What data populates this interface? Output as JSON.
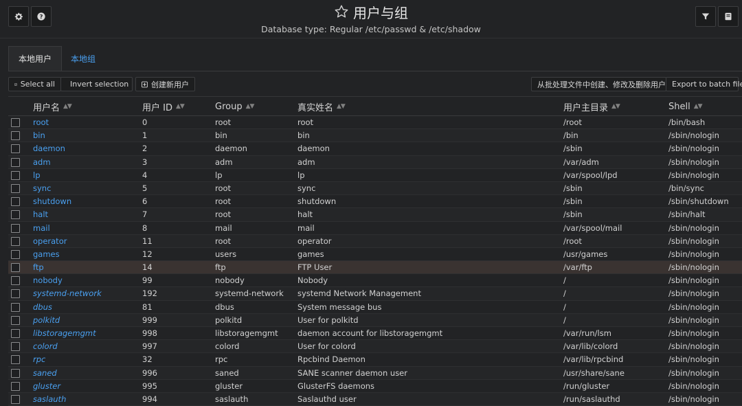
{
  "header": {
    "title": "用户与组",
    "subtitle": "Database type: Regular /etc/passwd & /etc/shadow"
  },
  "tabs": [
    {
      "label": "本地用户",
      "active": true
    },
    {
      "label": "本地组",
      "active": false
    }
  ],
  "toolbar": {
    "select_all": "Select all",
    "invert_selection": "Invert selection",
    "create_user": "创建新用户",
    "batch_file": "从批处理文件中创建、修改及删除用户",
    "export_batch": "Export to batch file"
  },
  "columns": {
    "username": "用户名",
    "uid": "用户 ID",
    "group": "Group",
    "real_name": "真实姓名",
    "home": "用户主目录",
    "shell": "Shell"
  },
  "users": [
    {
      "name": "root",
      "uid": "0",
      "group": "root",
      "real": "root",
      "home": "/root",
      "shell": "/bin/bash",
      "system": false
    },
    {
      "name": "bin",
      "uid": "1",
      "group": "bin",
      "real": "bin",
      "home": "/bin",
      "shell": "/sbin/nologin",
      "system": false
    },
    {
      "name": "daemon",
      "uid": "2",
      "group": "daemon",
      "real": "daemon",
      "home": "/sbin",
      "shell": "/sbin/nologin",
      "system": false
    },
    {
      "name": "adm",
      "uid": "3",
      "group": "adm",
      "real": "adm",
      "home": "/var/adm",
      "shell": "/sbin/nologin",
      "system": false
    },
    {
      "name": "lp",
      "uid": "4",
      "group": "lp",
      "real": "lp",
      "home": "/var/spool/lpd",
      "shell": "/sbin/nologin",
      "system": false
    },
    {
      "name": "sync",
      "uid": "5",
      "group": "root",
      "real": "sync",
      "home": "/sbin",
      "shell": "/bin/sync",
      "system": false
    },
    {
      "name": "shutdown",
      "uid": "6",
      "group": "root",
      "real": "shutdown",
      "home": "/sbin",
      "shell": "/sbin/shutdown",
      "system": false
    },
    {
      "name": "halt",
      "uid": "7",
      "group": "root",
      "real": "halt",
      "home": "/sbin",
      "shell": "/sbin/halt",
      "system": false
    },
    {
      "name": "mail",
      "uid": "8",
      "group": "mail",
      "real": "mail",
      "home": "/var/spool/mail",
      "shell": "/sbin/nologin",
      "system": false
    },
    {
      "name": "operator",
      "uid": "11",
      "group": "root",
      "real": "operator",
      "home": "/root",
      "shell": "/sbin/nologin",
      "system": false
    },
    {
      "name": "games",
      "uid": "12",
      "group": "users",
      "real": "games",
      "home": "/usr/games",
      "shell": "/sbin/nologin",
      "system": false
    },
    {
      "name": "ftp",
      "uid": "14",
      "group": "ftp",
      "real": "FTP User",
      "home": "/var/ftp",
      "shell": "/sbin/nologin",
      "system": false,
      "highlight": true
    },
    {
      "name": "nobody",
      "uid": "99",
      "group": "nobody",
      "real": "Nobody",
      "home": "/",
      "shell": "/sbin/nologin",
      "system": false
    },
    {
      "name": "systemd-network",
      "uid": "192",
      "group": "systemd-network",
      "real": "systemd Network Management",
      "home": "/",
      "shell": "/sbin/nologin",
      "system": true
    },
    {
      "name": "dbus",
      "uid": "81",
      "group": "dbus",
      "real": "System message bus",
      "home": "/",
      "shell": "/sbin/nologin",
      "system": true
    },
    {
      "name": "polkitd",
      "uid": "999",
      "group": "polkitd",
      "real": "User for polkitd",
      "home": "/",
      "shell": "/sbin/nologin",
      "system": true
    },
    {
      "name": "libstoragemgmt",
      "uid": "998",
      "group": "libstoragemgmt",
      "real": "daemon account for libstoragemgmt",
      "home": "/var/run/lsm",
      "shell": "/sbin/nologin",
      "system": true
    },
    {
      "name": "colord",
      "uid": "997",
      "group": "colord",
      "real": "User for colord",
      "home": "/var/lib/colord",
      "shell": "/sbin/nologin",
      "system": true
    },
    {
      "name": "rpc",
      "uid": "32",
      "group": "rpc",
      "real": "Rpcbind Daemon",
      "home": "/var/lib/rpcbind",
      "shell": "/sbin/nologin",
      "system": true
    },
    {
      "name": "saned",
      "uid": "996",
      "group": "saned",
      "real": "SANE scanner daemon user",
      "home": "/usr/share/sane",
      "shell": "/sbin/nologin",
      "system": true
    },
    {
      "name": "gluster",
      "uid": "995",
      "group": "gluster",
      "real": "GlusterFS daemons",
      "home": "/run/gluster",
      "shell": "/sbin/nologin",
      "system": true
    },
    {
      "name": "saslauth",
      "uid": "994",
      "group": "saslauth",
      "real": "Saslauthd user",
      "home": "/run/saslauthd",
      "shell": "/sbin/nologin",
      "system": true
    }
  ],
  "colors": {
    "background": "#222325",
    "link": "#4aa0f0",
    "highlight_row": "#3a3331"
  },
  "icons": {
    "top_left": [
      "gear-icon",
      "question-icon"
    ],
    "top_right": [
      "filter-icon",
      "book-icon"
    ],
    "title": "star-outline-icon"
  }
}
